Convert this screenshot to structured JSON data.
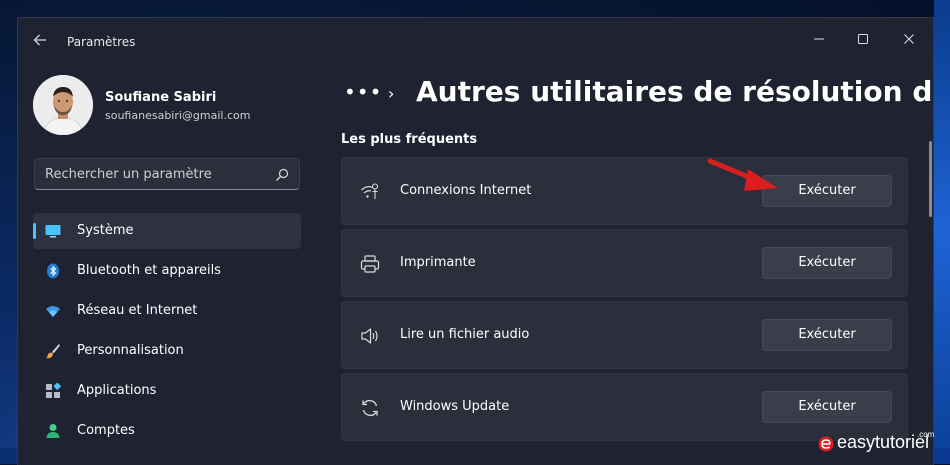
{
  "window": {
    "title": "Paramètres"
  },
  "user": {
    "name": "Soufiane Sabiri",
    "email": "soufianesabiri@gmail.com"
  },
  "search": {
    "placeholder": "Rechercher un paramètre"
  },
  "sidebar": {
    "items": [
      {
        "label": "Système",
        "icon": "monitor-icon",
        "active": true
      },
      {
        "label": "Bluetooth et appareils",
        "icon": "bluetooth-icon"
      },
      {
        "label": "Réseau et Internet",
        "icon": "wifi-icon"
      },
      {
        "label": "Personnalisation",
        "icon": "paintbrush-icon"
      },
      {
        "label": "Applications",
        "icon": "apps-icon"
      },
      {
        "label": "Comptes",
        "icon": "person-icon"
      }
    ]
  },
  "breadcrumb": {
    "dots": "•••",
    "chevron": "›"
  },
  "page": {
    "title": "Autres utilitaires de résolution des problè"
  },
  "section": {
    "title": "Les plus fréquents"
  },
  "troubleshooters": [
    {
      "label": "Connexions Internet",
      "icon": "wifi-settings-icon",
      "button": "Exécuter"
    },
    {
      "label": "Imprimante",
      "icon": "printer-icon",
      "button": "Exécuter"
    },
    {
      "label": "Lire un fichier audio",
      "icon": "speaker-icon",
      "button": "Exécuter"
    },
    {
      "label": "Windows Update",
      "icon": "sync-icon",
      "button": "Exécuter"
    }
  ],
  "watermark": {
    "text": "easytutoriel",
    "suffix": ".com"
  },
  "colors": {
    "accent": "#4cc2ff",
    "annotation_arrow": "#d81e1e",
    "window_bg": "#1f2331",
    "card_bg": "#2b2f3b"
  }
}
